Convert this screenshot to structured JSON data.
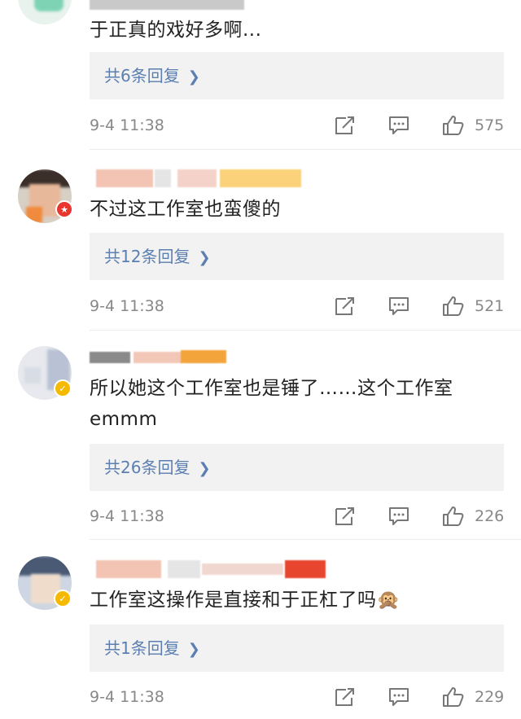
{
  "comments": [
    {
      "text": "于正真的戏好多啊...",
      "replies": "共6条回复",
      "time": "9-4 11:38",
      "likes": "575"
    },
    {
      "text": "不过这工作室也蛮傻的",
      "replies": "共12条回复",
      "time": "9-4 11:38",
      "likes": "521"
    },
    {
      "text": "所以她这个工作室也是锤了……这个工作室emmm",
      "replies": "共26条回复",
      "time": "9-4 11:38",
      "likes": "226"
    },
    {
      "text": "工作室这操作是直接和于正杠了吗🙊",
      "replies": "共1条回复",
      "time": "9-4 11:38",
      "likes": "229"
    }
  ],
  "icons": {
    "share": "share-icon",
    "comment": "comment-icon",
    "like": "thumbs-up-icon",
    "chevron": "chevron-right-icon"
  },
  "colors": {
    "reply_link": "#5b7fb0",
    "meta": "#888888",
    "reply_bg": "#f2f2f2"
  }
}
